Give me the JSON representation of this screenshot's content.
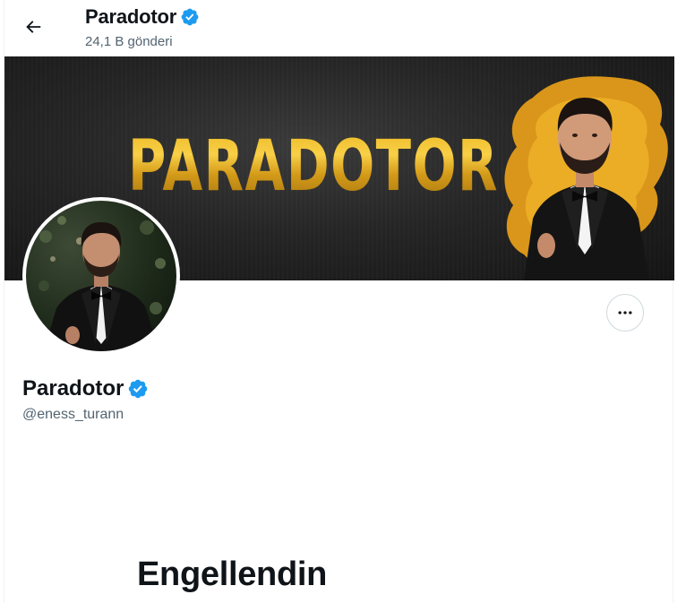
{
  "header": {
    "back_icon": "arrow-left-icon",
    "title": "Paradotor",
    "subtitle": "24,1 B gönderi",
    "verified_icon": "verified-badge-icon"
  },
  "banner": {
    "brand_text": "PARADOTOR",
    "accent_color": "#e7b41d"
  },
  "profile": {
    "name": "Paradotor",
    "handle": "@eness_turann",
    "verified_color": "#1d9bf0",
    "more_icon": "more-horizontal-icon"
  },
  "blocked": {
    "title": "Engellendin"
  }
}
